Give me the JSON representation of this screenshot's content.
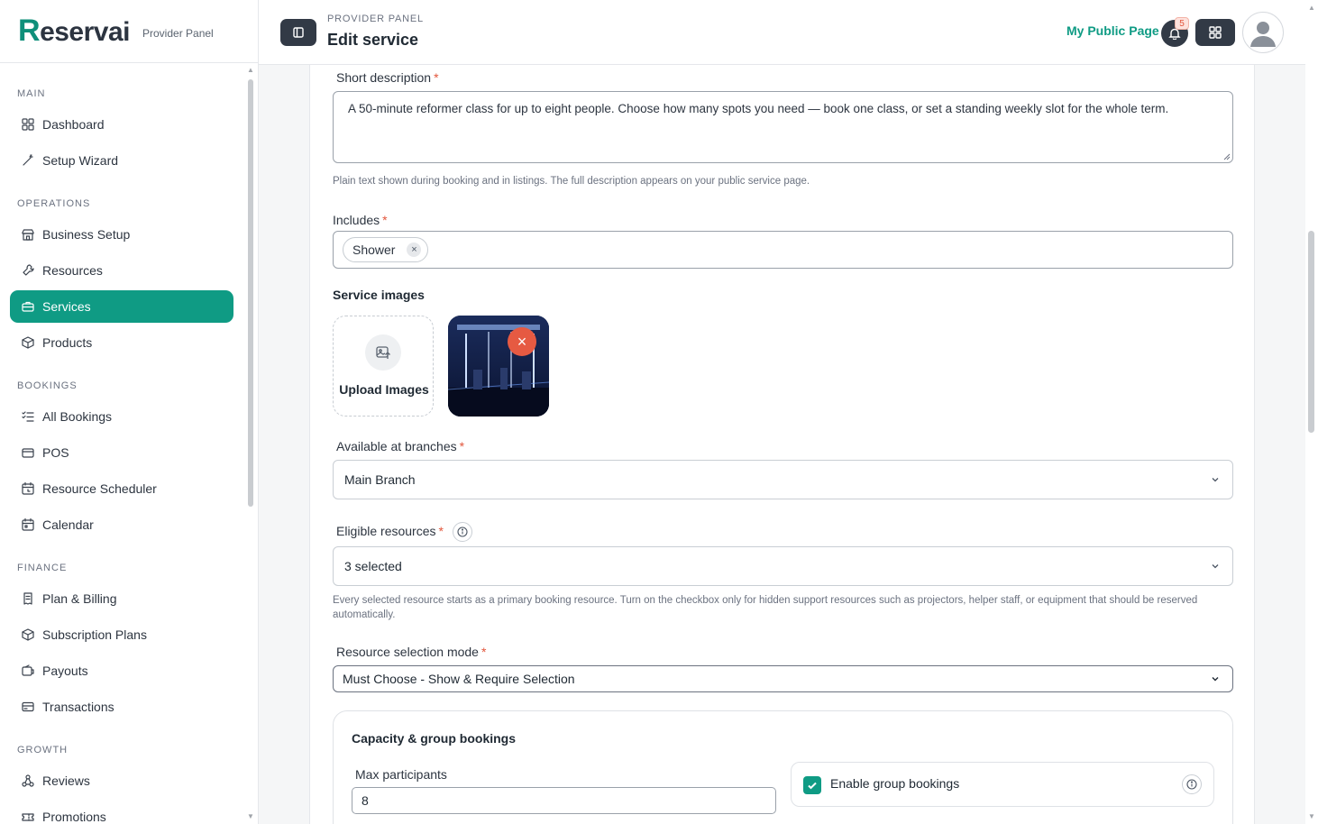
{
  "brand": {
    "logo_initial": "R",
    "logo_rest": "eservai",
    "subtitle": "Provider Panel"
  },
  "sidebar": {
    "sections": [
      {
        "label": "MAIN",
        "items": [
          {
            "label": "Dashboard",
            "icon": "grid-icon"
          },
          {
            "label": "Setup Wizard",
            "icon": "magic-wand-icon"
          }
        ]
      },
      {
        "label": "OPERATIONS",
        "items": [
          {
            "label": "Business Setup",
            "icon": "store-icon"
          },
          {
            "label": "Resources",
            "icon": "tools-icon"
          },
          {
            "label": "Services",
            "icon": "briefcase-icon",
            "active": true
          },
          {
            "label": "Products",
            "icon": "box-icon"
          }
        ]
      },
      {
        "label": "BOOKINGS",
        "items": [
          {
            "label": "All Bookings",
            "icon": "list-check-icon"
          },
          {
            "label": "POS",
            "icon": "wallet-icon"
          },
          {
            "label": "Resource Scheduler",
            "icon": "calendar-clock-icon"
          },
          {
            "label": "Calendar",
            "icon": "calendar-icon"
          }
        ]
      },
      {
        "label": "FINANCE",
        "items": [
          {
            "label": "Plan & Billing",
            "icon": "receipt-icon"
          },
          {
            "label": "Subscription Plans",
            "icon": "box-icon"
          },
          {
            "label": "Payouts",
            "icon": "payout-icon"
          },
          {
            "label": "Transactions",
            "icon": "card-icon"
          }
        ]
      },
      {
        "label": "GROWTH",
        "items": [
          {
            "label": "Reviews",
            "icon": "network-icon"
          },
          {
            "label": "Promotions",
            "icon": "ticket-icon"
          }
        ]
      }
    ]
  },
  "header": {
    "breadcrumb": "PROVIDER PANEL",
    "title": "Edit service",
    "public_link": "My Public Page",
    "notification_count": "5"
  },
  "form": {
    "short_description": {
      "label": "Short description",
      "required_mark": "*",
      "value": "A 50-minute reformer class for up to eight people. Choose how many spots you need — book one class, or set a standing weekly slot for the whole term.",
      "hint": "Plain text shown during booking and in listings. The full description appears on your public service page."
    },
    "includes": {
      "label": "Includes",
      "required_mark": "*",
      "chips": [
        "Shower"
      ],
      "chip_remove": "×"
    },
    "images": {
      "label": "Service images",
      "upload_label": "Upload Images",
      "remove_symbol": "×"
    },
    "branches": {
      "label": "Available at branches",
      "required_mark": "*",
      "value": "Main Branch"
    },
    "resources": {
      "label": "Eligible resources",
      "required_mark": "*",
      "value": "3 selected",
      "hint": "Every selected resource starts as a primary booking resource. Turn on the checkbox only for hidden support resources such as projectors, helper staff, or equipment that should be reserved automatically."
    },
    "selection_mode": {
      "label": "Resource selection mode",
      "required_mark": "*",
      "value": "Must Choose - Show & Require Selection"
    },
    "capacity": {
      "title": "Capacity & group bookings",
      "max_label": "Max participants",
      "max_value": "8",
      "group_label": "Enable group bookings",
      "group_enabled": true
    }
  },
  "colors": {
    "accent": "#0f9b84",
    "dark": "#323a46",
    "danger": "#e65a42"
  }
}
